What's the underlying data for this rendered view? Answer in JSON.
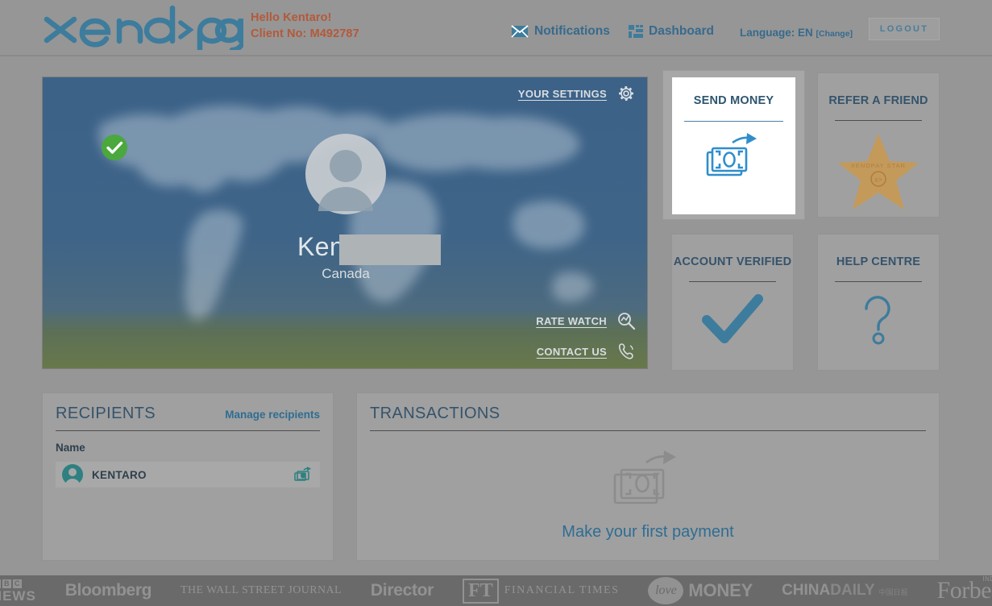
{
  "header": {
    "logo_text": "xend>pay",
    "greeting": "Hello Kentaro!",
    "client_no": "Client No: M492787",
    "notifications_label": "Notifications",
    "notifications_icon": "envelope-icon",
    "dashboard_label": "Dashboard",
    "dashboard_icon": "grid-tiles-icon",
    "language_label": "Language: EN",
    "language_change": "[Change]",
    "logout_label": "LOGOUT",
    "accent_orange": "#b4593a",
    "accent_blue": "#376a8c"
  },
  "hero": {
    "settings_label": "YOUR SETTINGS",
    "settings_icon": "gear-icon",
    "user_name": "Kentaro",
    "user_country": "Canada",
    "avatar_icon": "user-avatar-icon",
    "verified_badge_icon": "green-check-badge-icon",
    "rate_watch_label": "RATE WATCH",
    "rate_watch_icon": "magnifier-rate-icon",
    "contact_us_label": "CONTACT US",
    "contact_us_icon": "phone-icon",
    "sky_color": "#3c6288",
    "grass_color": "#68784a"
  },
  "tiles": [
    {
      "id": "send-money",
      "title": "SEND MONEY",
      "icon": "banknote-send-icon",
      "icon_color": "#2f8ecb",
      "active": true
    },
    {
      "id": "refer-a-friend",
      "title": "REFER A FRIEND",
      "icon": "gold-star-icon",
      "star_text": "XENDPAY STAR",
      "star_mark": "x>",
      "icon_color": "#c49a5a",
      "active": false
    },
    {
      "id": "account-verified",
      "title": "ACCOUNT VERIFIED",
      "icon": "checkmark-icon",
      "icon_color": "#3d7c9c",
      "active": false
    },
    {
      "id": "help-centre",
      "title": "HELP CENTRE",
      "icon": "question-mark-icon",
      "icon_color": "#3d7c9c",
      "active": false
    }
  ],
  "recipients": {
    "title": "RECIPIENTS",
    "manage_link": "Manage recipients",
    "column_header": "Name",
    "rows": [
      {
        "name": "KENTARO",
        "avatar_icon": "recipient-avatar-icon",
        "action_icon": "send-money-small-icon",
        "icon_color": "#2f8080"
      }
    ]
  },
  "transactions": {
    "title": "TRANSACTIONS",
    "empty_icon": "banknote-send-outline-icon",
    "empty_label": "Make your first payment",
    "link_color": "#2f6d92"
  },
  "footer": {
    "logos": [
      {
        "id": "bbc-news",
        "line1": "BBC",
        "line2": "NEWS"
      },
      {
        "id": "bloomberg",
        "text": "Bloomberg"
      },
      {
        "id": "wall-street-journal",
        "text": "THE WALL STREET JOURNAL"
      },
      {
        "id": "director",
        "text": "Director"
      },
      {
        "id": "financial-times",
        "mark": "FT",
        "text": "FINANCIAL TIMES"
      },
      {
        "id": "love-money",
        "mark": "love",
        "text": "MONEY"
      },
      {
        "id": "china-daily",
        "text1": "CHINA",
        "text2": "DAILY",
        "text3": "中国日报"
      },
      {
        "id": "forbes",
        "text": "Forbes",
        "sup": "INDIA"
      }
    ]
  }
}
